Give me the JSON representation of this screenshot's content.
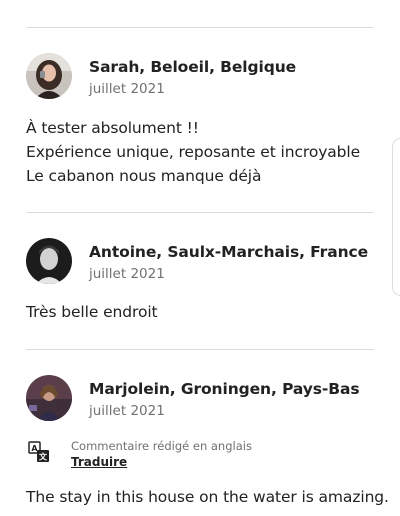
{
  "reviews": [
    {
      "name": "Sarah, Beloeil, Belgique",
      "date": "juillet 2021",
      "lines": [
        "À tester absolument !!",
        "Expérience unique, reposante et incroyable",
        "Le cabanon nous manque déjà"
      ]
    },
    {
      "name": "Antoine, Saulx-Marchais, France",
      "date": "juillet 2021",
      "lines": [
        "Très belle endroit"
      ]
    },
    {
      "name": "Marjolein, Groningen, Pays-Bas",
      "date": "juillet 2021",
      "translation": {
        "note": "Commentaire rédigé en anglais",
        "link": "Traduire"
      },
      "lines": [
        "The stay in this house on the water is amazing."
      ]
    }
  ],
  "icons": {
    "translate": "translate-icon"
  },
  "colors": {
    "text": "#222222",
    "secondary": "#717171",
    "divider": "#dddddd"
  }
}
